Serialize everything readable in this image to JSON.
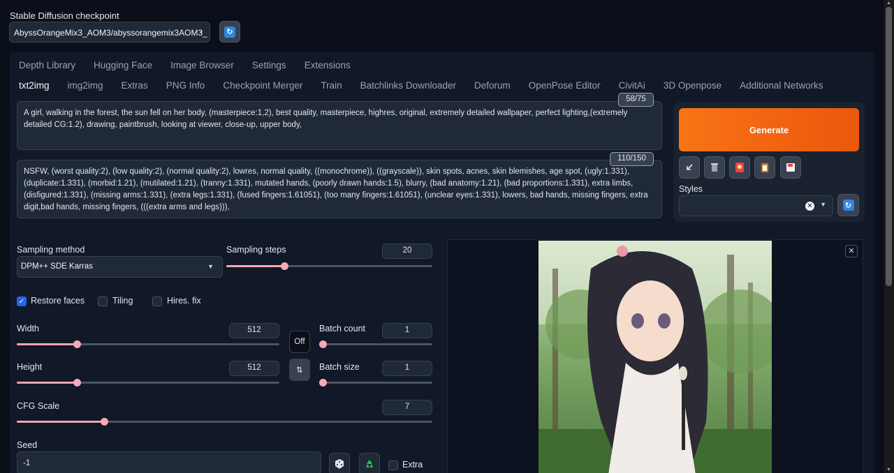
{
  "checkpoint": {
    "label": "Stable Diffusion checkpoint",
    "value": "AbyssOrangeMix3_AOM3/abyssorangemix3AOM3_"
  },
  "tabs_top": [
    "Depth Library",
    "Hugging Face",
    "Image Browser",
    "Settings",
    "Extensions"
  ],
  "tabs_main": [
    "txt2img",
    "img2img",
    "Extras",
    "PNG Info",
    "Checkpoint Merger",
    "Train",
    "Batchlinks Downloader",
    "Deforum",
    "OpenPose Editor",
    "CivitAi",
    "3D Openpose",
    "Additional Networks"
  ],
  "selected_tab": "txt2img",
  "prompt": {
    "text": "A girl, walking in the forest, the sun fell on her body, (masterpiece:1,2), best quality, masterpiece, highres, original, extremely detailed wallpaper, perfect lighting,(extremely detailed CG:1.2), drawing, paintbrush, looking at viewer, close-up, upper body,",
    "counter": "58/75"
  },
  "negative_prompt": {
    "text": "NSFW, (worst quality:2), (low quality:2), (normal quality:2), lowres, normal quality, ((monochrome)), ((grayscale)), skin spots, acnes, skin blemishes, age spot, (ugly:1.331), (duplicate:1.331), (morbid:1.21), (mutilated:1.21), (tranny:1.331), mutated hands, (poorly drawn hands:1.5), blurry, (bad anatomy:1.21), (bad proportions:1.331), extra limbs, (disfigured:1.331), (missing arms:1.331), (extra legs:1.331), (fused fingers:1.61051), (too many fingers:1.61051), (unclear eyes:1.331), lowers, bad hands, missing fingers, extra digit,bad hands, missing fingers, (((extra arms and legs))),",
    "counter": "110/150"
  },
  "generate_label": "Generate",
  "styles": {
    "label": "Styles",
    "clear": "✕"
  },
  "sampling": {
    "method_label": "Sampling method",
    "method_value": "DPM++ SDE Karras",
    "steps_label": "Sampling steps",
    "steps_value": "20",
    "steps_fraction": 0.28
  },
  "checkboxes": {
    "restore_faces": {
      "label": "Restore faces",
      "checked": true
    },
    "tiling": {
      "label": "Tiling",
      "checked": false
    },
    "hires_fix": {
      "label": "Hires. fix",
      "checked": false
    }
  },
  "width": {
    "label": "Width",
    "value": "512",
    "fraction": 0.23
  },
  "height": {
    "label": "Height",
    "value": "512",
    "fraction": 0.23
  },
  "off_label": "Off",
  "swap_icon": "⇅",
  "batch_count": {
    "label": "Batch count",
    "value": "1",
    "fraction": 0.0
  },
  "batch_size": {
    "label": "Batch size",
    "value": "1",
    "fraction": 0.0
  },
  "cfg": {
    "label": "CFG Scale",
    "value": "7",
    "fraction": 0.21
  },
  "seed": {
    "label": "Seed",
    "value": "-1"
  },
  "extra_label": "Extra",
  "output_close": "✕",
  "colors": {
    "accent": "#f97316",
    "slider": "#f4a6b4",
    "checkbox": "#2563eb"
  }
}
